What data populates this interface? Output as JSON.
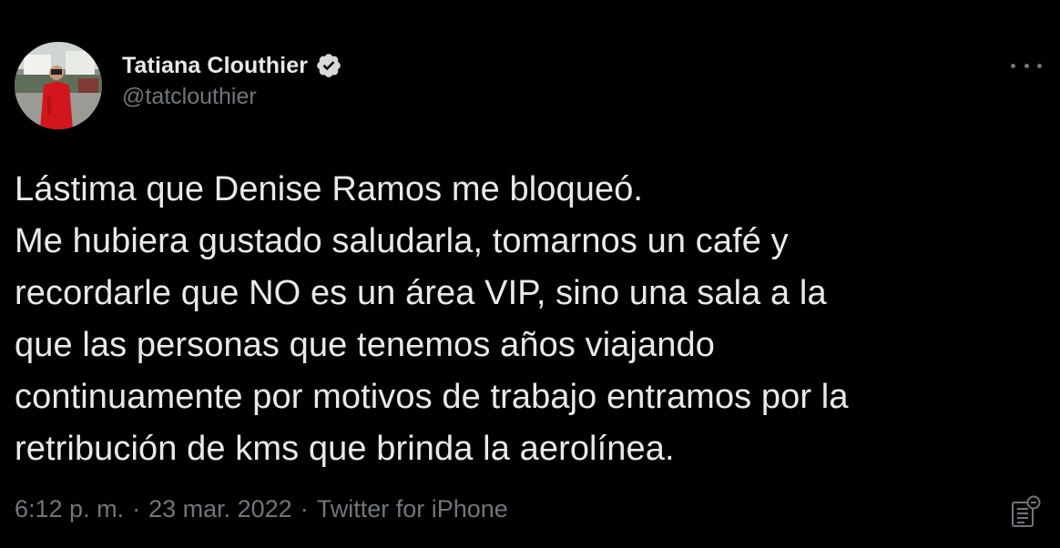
{
  "tweet": {
    "author": {
      "display_name": "Tatiana Clouthier",
      "handle": "@tatclouthier",
      "verified": true
    },
    "text_lines": [
      "Lástima que Denise Ramos me bloqueó.",
      "Me hubiera gustado saludarla, tomarnos un café y",
      "recordarle que NO es un área VIP, sino una sala a la",
      "que las personas que tenemos años viajando",
      "continuamente por motivos de trabajo entramos por la",
      "retribución de kms que brinda la aerolínea."
    ],
    "time": "6:12 p. m.",
    "date": "23 mar. 2022",
    "separator": "·",
    "client": "Twitter for iPhone"
  },
  "icons": {
    "verified": "verified-badge-icon",
    "more": "more-dots-icon",
    "analytics": "analytics-icon"
  },
  "colors": {
    "background": "#000000",
    "primary_text": "#e7e9ea",
    "secondary_text": "#71767b",
    "badge": "#d9d9d9"
  }
}
